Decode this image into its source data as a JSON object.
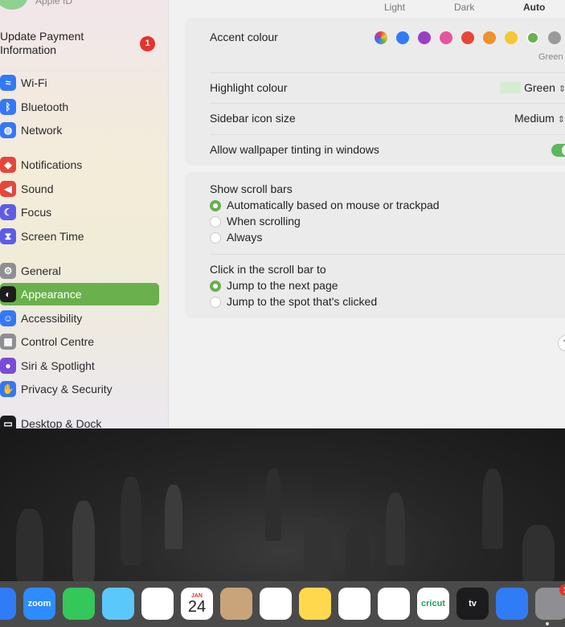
{
  "sidebar": {
    "apple_id_label": "Apple ID",
    "update": {
      "label": "Update Payment Information",
      "badge": "1"
    },
    "items": [
      {
        "label": "Wi-Fi",
        "icon": "wifi-icon",
        "color": "#3478f6"
      },
      {
        "label": "Bluetooth",
        "icon": "bluetooth-icon",
        "color": "#3478f6"
      },
      {
        "label": "Network",
        "icon": "globe-icon",
        "color": "#3478f6"
      },
      {
        "label": "Notifications",
        "icon": "bell-icon",
        "color": "#e5463a"
      },
      {
        "label": "Sound",
        "icon": "speaker-icon",
        "color": "#e5463a"
      },
      {
        "label": "Focus",
        "icon": "moon-icon",
        "color": "#5e5ce6"
      },
      {
        "label": "Screen Time",
        "icon": "hourglass-icon",
        "color": "#5e5ce6"
      },
      {
        "label": "General",
        "icon": "gear-icon",
        "color": "#8e8e93"
      },
      {
        "label": "Appearance",
        "icon": "appearance-icon",
        "color": "#1c1c1e"
      },
      {
        "label": "Accessibility",
        "icon": "accessibility-icon",
        "color": "#3478f6"
      },
      {
        "label": "Control Centre",
        "icon": "control-centre-icon",
        "color": "#8e8e93"
      },
      {
        "label": "Siri & Spotlight",
        "icon": "siri-icon",
        "color": "#7a4bd8"
      },
      {
        "label": "Privacy & Security",
        "icon": "hand-icon",
        "color": "#3478f6"
      },
      {
        "label": "Desktop & Dock",
        "icon": "dock-icon",
        "color": "#1c1c1e"
      }
    ],
    "active_item": "Appearance"
  },
  "appearance": {
    "modes": [
      "Light",
      "Dark",
      "Auto"
    ],
    "accent": {
      "label": "Accent colour",
      "colors": [
        "#multicolor",
        "#2f7cf6",
        "#9a3fc4",
        "#e5559b",
        "#e5463a",
        "#f0902e",
        "#f4c82f",
        "#6ab04c",
        "#9a9a9a"
      ],
      "selected_name": "Green"
    },
    "highlight": {
      "label": "Highlight colour",
      "value": "Green",
      "swatch": "#d6ecd2"
    },
    "sidebar_icon_size": {
      "label": "Sidebar icon size",
      "value": "Medium"
    },
    "wallpaper_tinting": {
      "label": "Allow wallpaper tinting in windows",
      "enabled": true
    },
    "scroll_bars": {
      "label": "Show scroll bars",
      "options": [
        "Automatically based on mouse or trackpad",
        "When scrolling",
        "Always"
      ],
      "selected": 0
    },
    "click_scroll": {
      "label": "Click in the scroll bar to",
      "options": [
        "Jump to the next page",
        "Jump to the spot that's clicked"
      ],
      "selected": 0
    },
    "help": "?"
  },
  "dock": {
    "apps": [
      {
        "name": "finder-icon",
        "label": "",
        "color": "#2f7cf6"
      },
      {
        "name": "zoom-icon",
        "label": "zoom",
        "color": "#2d8cff"
      },
      {
        "name": "facetime-icon",
        "label": "",
        "color": "#34c759"
      },
      {
        "name": "maps-icon",
        "label": "",
        "color": "#5ac8fa"
      },
      {
        "name": "photos-icon",
        "label": "",
        "color": "#ffffff"
      },
      {
        "name": "calendar-icon",
        "label": "24",
        "month": "JAN",
        "color": "#ffffff"
      },
      {
        "name": "contacts-icon",
        "label": "",
        "color": "#c9a37a"
      },
      {
        "name": "reminders-icon",
        "label": "",
        "color": "#ffffff"
      },
      {
        "name": "notes-icon",
        "label": "",
        "color": "#ffd84d"
      },
      {
        "name": "freeform-icon",
        "label": "",
        "color": "#ffffff"
      },
      {
        "name": "shortcuts-icon",
        "label": "",
        "color": "#ffffff"
      },
      {
        "name": "cricut-icon",
        "label": "cricut",
        "color": "#ffffff"
      },
      {
        "name": "apple-tv-icon",
        "label": "tv",
        "color": "#1c1c1e"
      },
      {
        "name": "keynote-icon",
        "label": "",
        "color": "#2f7cf6"
      },
      {
        "name": "system-settings-icon",
        "label": "",
        "color": "#8e8e93",
        "badge": "1"
      }
    ]
  }
}
